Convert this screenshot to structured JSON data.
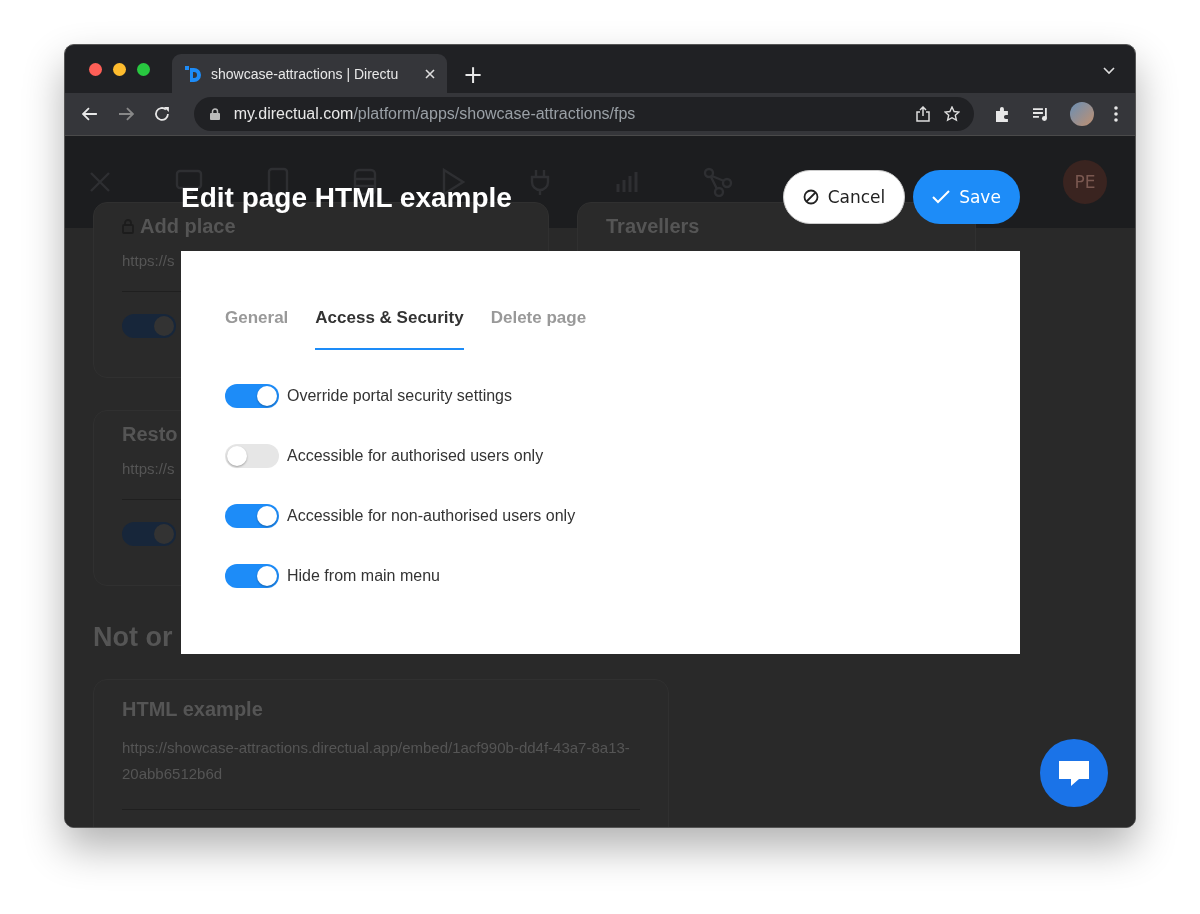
{
  "browser": {
    "tab": {
      "title": "showcase-attractions | Directu"
    },
    "new_tab": "+",
    "address": {
      "host": "my.directual.com",
      "path": "/platform/apps/showcase-attractions/fps"
    }
  },
  "app": {
    "avatar": "PE"
  },
  "background": {
    "cards": [
      {
        "title": "Add place",
        "locked": true,
        "url": "https://s",
        "on": true
      },
      {
        "title": "Travellers",
        "locked": false
      },
      {
        "title": "Resto",
        "locked": false,
        "url": "https://s",
        "on": true
      }
    ],
    "section_title": "Not or",
    "embed_card": {
      "title": "HTML example",
      "url": "https://showcase-attractions.directual.app/embed/1acf990b-dd4f-43a7-8a13-20abb6512b6d"
    }
  },
  "dialog": {
    "title": "Edit page HTML example",
    "cancel": "Cancel",
    "save": "Save",
    "tabs": [
      {
        "label": "General",
        "selected": false
      },
      {
        "label": "Access & Security",
        "selected": true
      },
      {
        "label": "Delete page",
        "selected": false
      }
    ],
    "toggles": [
      {
        "label": "Override portal security settings",
        "on": true
      },
      {
        "label": "Accessible for authorised users only",
        "on": false
      },
      {
        "label": "Accessible for non-authorised users only",
        "on": true
      },
      {
        "label": "Hide from main menu",
        "on": true
      }
    ]
  }
}
